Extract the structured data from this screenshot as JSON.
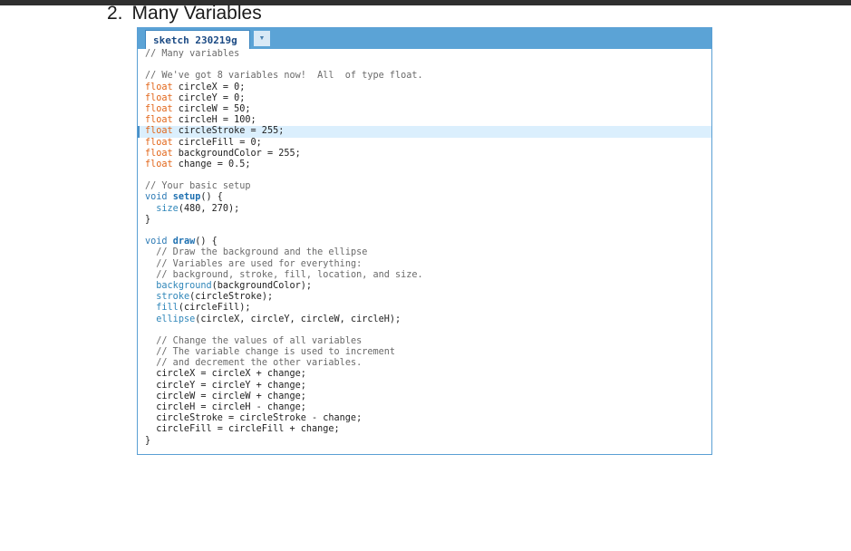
{
  "heading": {
    "number": "2.",
    "title": "Many Variables"
  },
  "editor": {
    "tab_label": "sketch 230219g",
    "tab_arrow": "▼",
    "lines": [
      "// Many variables",
      "",
      "// We've got 8 variables now!  All  of type float.",
      "float circleX = 0;",
      "float circleY = 0;",
      "float circleW = 50;",
      "float circleH = 100;",
      "float circleStroke = 255;",
      "float circleFill = 0;",
      "float backgroundColor = 255;",
      "float change = 0.5;",
      "",
      "// Your basic setup",
      "void setup() {",
      "  size(480, 270);",
      "}",
      "",
      "void draw() {",
      "  // Draw the background and the ellipse",
      "  // Variables are used for everything:",
      "  // background, stroke, fill, location, and size.",
      "  background(backgroundColor);",
      "  stroke(circleStroke);",
      "  fill(circleFill);",
      "  ellipse(circleX, circleY, circleW, circleH);",
      "",
      "  // Change the values of all variables",
      "  // The variable change is used to increment",
      "  // and decrement the other variables.",
      "  circleX = circleX + change;",
      "  circleY = circleY + change;",
      "  circleW = circleW + change;",
      "  circleH = circleH - change;",
      "  circleStroke = circleStroke - change;",
      "  circleFill = circleFill + change;",
      "}"
    ],
    "highlighted_line": 7
  }
}
